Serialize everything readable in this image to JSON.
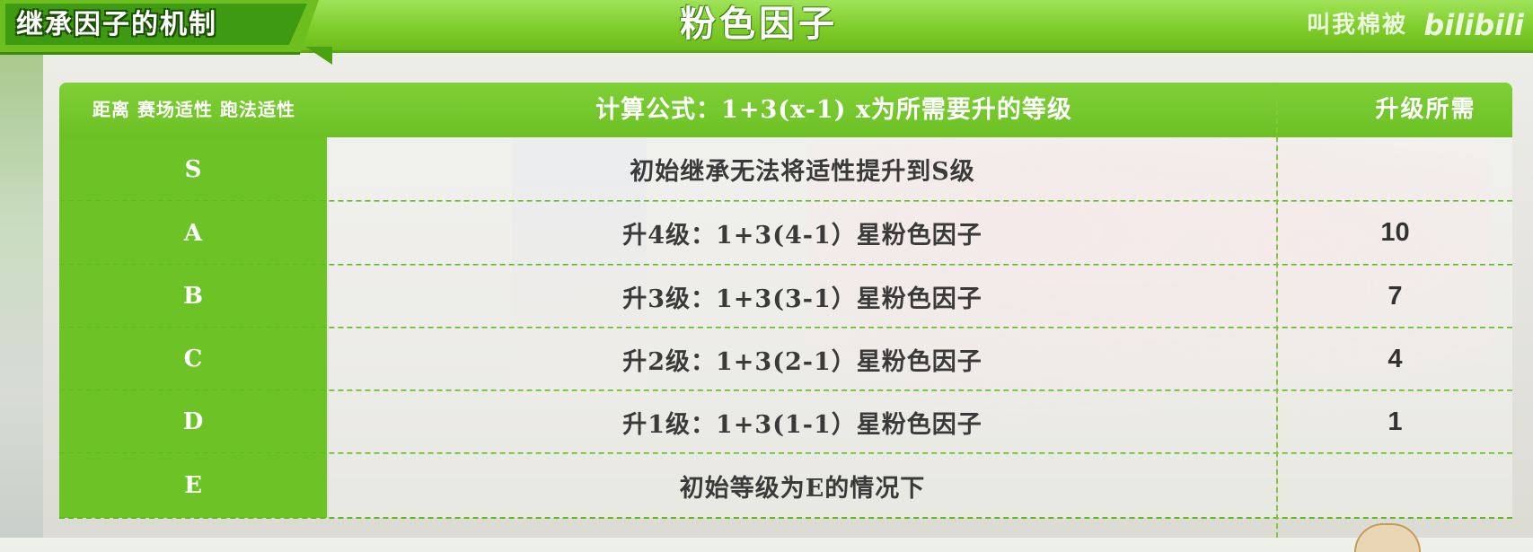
{
  "header": {
    "corner_title": "继承因子的机制",
    "main_title": "粉色因子",
    "watermark": "叫我棉被",
    "watermark_logo": "bilibili"
  },
  "table": {
    "col_left_header": "距离 赛场适性 跑法适性",
    "col_mid_header": "计算公式：1+3(x-1)  x为所需要升的等级",
    "col_right_header": "升级所需",
    "rows": [
      {
        "grade": "S",
        "formula": "初始继承无法将适性提升到S级",
        "value": ""
      },
      {
        "grade": "A",
        "formula": "升4级：1+3(4-1）星粉色因子",
        "value": "10"
      },
      {
        "grade": "B",
        "formula": "升3级：1+3(3-1）星粉色因子",
        "value": "7"
      },
      {
        "grade": "C",
        "formula": "升2级：1+3(2-1）星粉色因子",
        "value": "4"
      },
      {
        "grade": "D",
        "formula": "升1级：1+3(1-1）星粉色因子",
        "value": "1"
      },
      {
        "grade": "E",
        "formula": "初始等级为E的情况下",
        "value": ""
      }
    ]
  },
  "colors": {
    "accent_green": "#6dc226",
    "banner_green": "#7fcd2a",
    "dark_green": "#3e9a10"
  }
}
